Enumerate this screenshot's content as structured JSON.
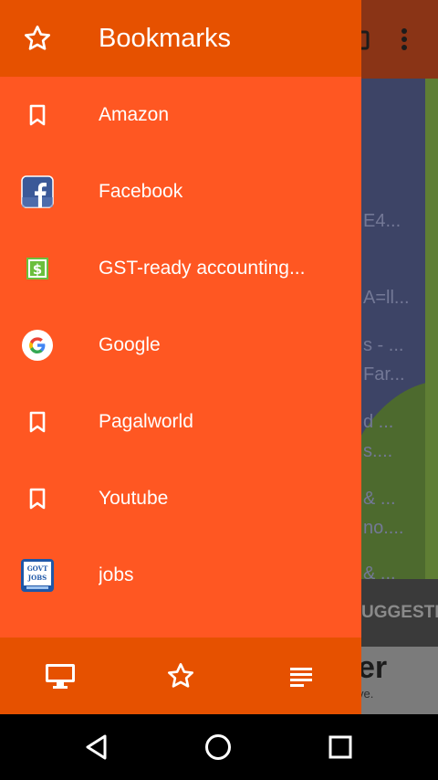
{
  "drawer": {
    "title": "Bookmarks",
    "header_icon": "star-outline-icon",
    "items": [
      {
        "label": "Amazon",
        "icon": "bookmark-icon"
      },
      {
        "label": "Facebook",
        "icon": "facebook-icon"
      },
      {
        "label": "GST-ready accounting...",
        "icon": "dollar-app-icon"
      },
      {
        "label": "Google",
        "icon": "google-icon"
      },
      {
        "label": "Pagalworld",
        "icon": "bookmark-icon"
      },
      {
        "label": "Youtube",
        "icon": "bookmark-icon"
      },
      {
        "label": "jobs",
        "icon": "govt-jobs-icon"
      }
    ],
    "footer": [
      "desktop-icon",
      "star-outline-icon",
      "reading-list-icon"
    ],
    "govt_jobs_logo": "GOVT JOBS"
  },
  "background": {
    "snippets": [
      "E4...",
      "A=ll...",
      "s - ...",
      "Far...",
      "d ...",
      "s....",
      "& ...",
      "no....",
      "& ..."
    ],
    "suggest": "UGGESTE",
    "card_big": "er",
    "card_small": "ve."
  },
  "navbar": [
    "back-icon",
    "home-icon",
    "recents-icon"
  ],
  "colors": {
    "drawer_bg": "#ff5722",
    "drawer_header": "#e65100",
    "text": "#ffffff"
  }
}
